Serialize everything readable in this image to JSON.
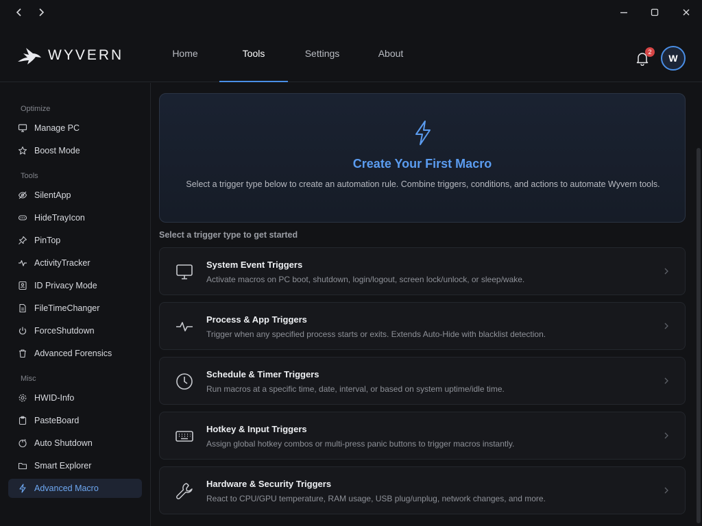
{
  "app": {
    "name": "WYVERN"
  },
  "header": {
    "tabs": [
      {
        "label": "Home"
      },
      {
        "label": "Tools"
      },
      {
        "label": "Settings"
      },
      {
        "label": "About"
      }
    ],
    "active_tab": "Tools",
    "notification_count": "2",
    "avatar_initial": "W"
  },
  "sidebar": {
    "sections": [
      {
        "title": "Optimize",
        "items": [
          {
            "label": "Manage PC",
            "icon": "monitor-icon"
          },
          {
            "label": "Boost Mode",
            "icon": "star-icon"
          }
        ]
      },
      {
        "title": "Tools",
        "items": [
          {
            "label": "SilentApp",
            "icon": "eye-off-icon"
          },
          {
            "label": "HideTrayIcon",
            "icon": "tray-icon"
          },
          {
            "label": "PinTop",
            "icon": "pin-icon"
          },
          {
            "label": "ActivityTracker",
            "icon": "activity-icon"
          },
          {
            "label": "ID Privacy Mode",
            "icon": "id-card-icon"
          },
          {
            "label": "FileTimeChanger",
            "icon": "file-clock-icon"
          },
          {
            "label": "ForceShutdown",
            "icon": "power-icon"
          },
          {
            "label": "Advanced Forensics",
            "icon": "trash-icon"
          }
        ]
      },
      {
        "title": "Misc",
        "items": [
          {
            "label": "HWID-Info",
            "icon": "gear-icon"
          },
          {
            "label": "PasteBoard",
            "icon": "clipboard-icon"
          },
          {
            "label": "Auto Shutdown",
            "icon": "timer-power-icon"
          },
          {
            "label": "Smart Explorer",
            "icon": "folder-icon"
          },
          {
            "label": "Advanced Macro",
            "icon": "lightning-icon"
          }
        ]
      }
    ],
    "active_item": "Advanced Macro"
  },
  "hero": {
    "title": "Create Your First Macro",
    "description": "Select a trigger type below to create an automation rule. Combine triggers, conditions, and actions to automate Wyvern tools.",
    "icon": "lightning-icon"
  },
  "select_label": "Select a trigger type to get started",
  "triggers": [
    {
      "title": "System Event Triggers",
      "description": "Activate macros on PC boot, shutdown, login/logout, screen lock/unlock, or sleep/wake.",
      "icon": "monitor-icon"
    },
    {
      "title": "Process & App Triggers",
      "description": "Trigger when any specified process starts or exits. Extends Auto-Hide with blacklist detection.",
      "icon": "pulse-icon"
    },
    {
      "title": "Schedule & Timer Triggers",
      "description": "Run macros at a specific time, date, interval, or based on system uptime/idle time.",
      "icon": "clock-icon"
    },
    {
      "title": "Hotkey & Input Triggers",
      "description": "Assign global hotkey combos or multi-press panic buttons to trigger macros instantly.",
      "icon": "keyboard-icon"
    },
    {
      "title": "Hardware & Security Triggers",
      "description": "React to CPU/GPU temperature, RAM usage, USB plug/unplug, network changes, and more.",
      "icon": "wrench-icon"
    }
  ],
  "colors": {
    "accent": "#4a8fe7",
    "background": "#121316",
    "badge": "#d64545"
  }
}
